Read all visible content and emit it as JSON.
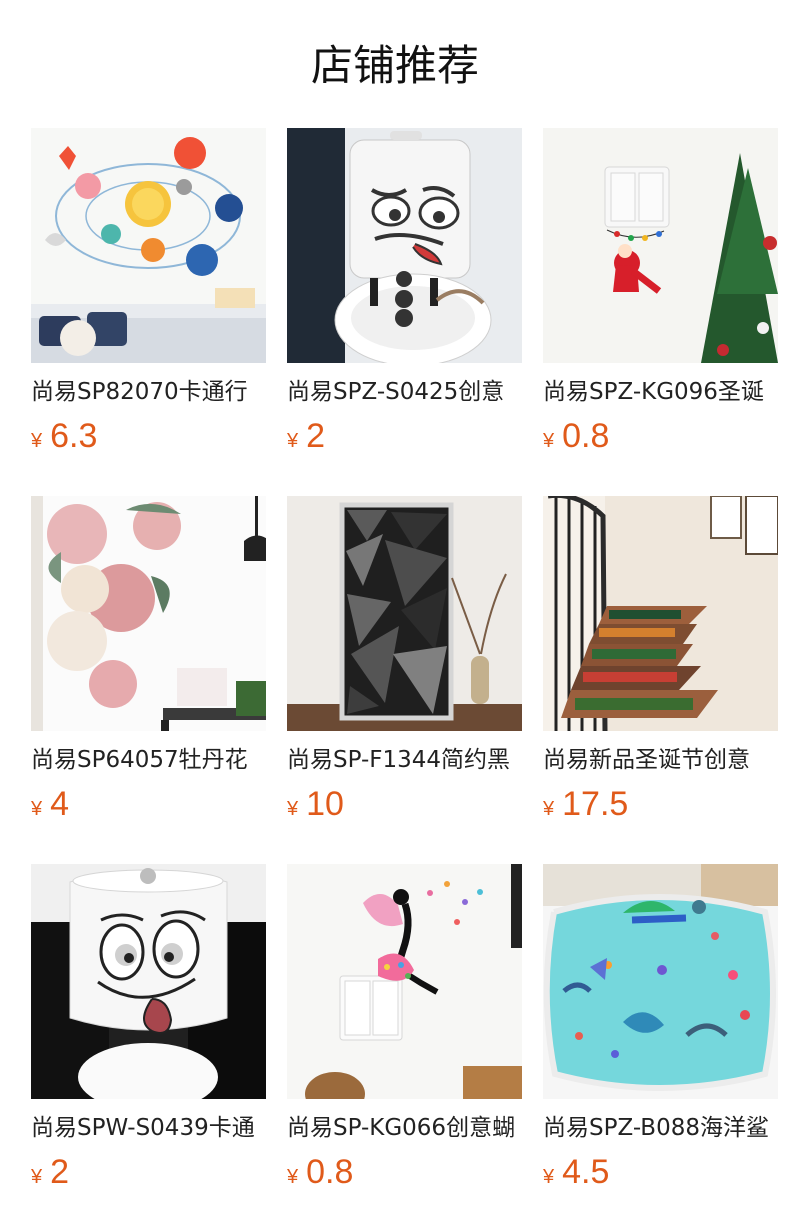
{
  "page": {
    "title": "店铺推荐"
  },
  "products": [
    {
      "name": "尚易SP82070卡通行",
      "currency": "¥",
      "price": "6.3",
      "image_icon": "solar-system-wall-sticker-image"
    },
    {
      "name": "尚易SPZ-S0425创意",
      "currency": "¥",
      "price": "2",
      "image_icon": "toilet-face-sticker-image"
    },
    {
      "name": "尚易SPZ-KG096圣诞",
      "currency": "¥",
      "price": "0.8",
      "image_icon": "christmas-switch-sticker-image"
    },
    {
      "name": "尚易SP64057牡丹花",
      "currency": "¥",
      "price": "4",
      "image_icon": "peony-wall-sticker-image"
    },
    {
      "name": "尚易SP-F1344简约黑",
      "currency": "¥",
      "price": "10",
      "image_icon": "black-geometric-door-sticker-image"
    },
    {
      "name": "尚易新品圣诞节创意",
      "currency": "¥",
      "price": "17.5",
      "image_icon": "christmas-stair-sticker-image"
    },
    {
      "name": "尚易SPW-S0439卡通",
      "currency": "¥",
      "price": "2",
      "image_icon": "smiling-toilet-sticker-image"
    },
    {
      "name": "尚易SP-KG066创意蝴",
      "currency": "¥",
      "price": "0.8",
      "image_icon": "fairy-butterfly-switch-sticker-image"
    },
    {
      "name": "尚易SPZ-B088海洋鲨",
      "currency": "¥",
      "price": "4.5",
      "image_icon": "ocean-bathtub-sticker-image"
    }
  ],
  "colors": {
    "price": "#e05a1a",
    "title": "#111111",
    "product_name": "#222222"
  }
}
